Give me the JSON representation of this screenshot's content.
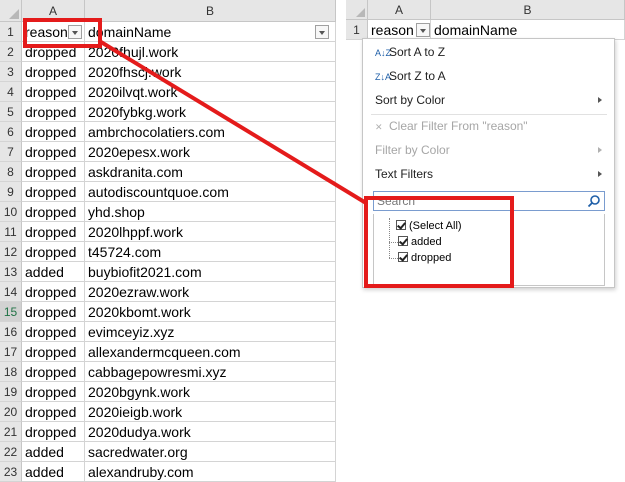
{
  "left_sheet": {
    "col_a": "A",
    "col_b": "B",
    "active_row": 15,
    "rows": [
      {
        "num": "1",
        "a": "reason",
        "b": "domainName"
      },
      {
        "num": "2",
        "a": "dropped",
        "b": "2020fhujl.work"
      },
      {
        "num": "3",
        "a": "dropped",
        "b": "2020fhscj.work"
      },
      {
        "num": "4",
        "a": "dropped",
        "b": "2020ilvqt.work"
      },
      {
        "num": "5",
        "a": "dropped",
        "b": "2020fybkg.work"
      },
      {
        "num": "6",
        "a": "dropped",
        "b": "ambrchocolatiers.com"
      },
      {
        "num": "7",
        "a": "dropped",
        "b": "2020epesx.work"
      },
      {
        "num": "8",
        "a": "dropped",
        "b": "askdranita.com"
      },
      {
        "num": "9",
        "a": "dropped",
        "b": "autodiscountquoe.com"
      },
      {
        "num": "10",
        "a": "dropped",
        "b": "yhd.shop"
      },
      {
        "num": "11",
        "a": "dropped",
        "b": "2020lhppf.work"
      },
      {
        "num": "12",
        "a": "dropped",
        "b": "t45724.com"
      },
      {
        "num": "13",
        "a": "added",
        "b": "buybiofit2021.com"
      },
      {
        "num": "14",
        "a": "dropped",
        "b": "2020ezraw.work"
      },
      {
        "num": "15",
        "a": "dropped",
        "b": "2020kbomt.work"
      },
      {
        "num": "16",
        "a": "dropped",
        "b": "evimceyiz.xyz"
      },
      {
        "num": "17",
        "a": "dropped",
        "b": "allexandermcqueen.com"
      },
      {
        "num": "18",
        "a": "dropped",
        "b": "cabbagepowresmi.xyz"
      },
      {
        "num": "19",
        "a": "dropped",
        "b": "2020bgynk.work"
      },
      {
        "num": "20",
        "a": "dropped",
        "b": "2020ieigb.work"
      },
      {
        "num": "21",
        "a": "dropped",
        "b": "2020dudya.work"
      },
      {
        "num": "22",
        "a": "added",
        "b": "sacredwater.org"
      },
      {
        "num": "23",
        "a": "added",
        "b": "alexandruby.com"
      }
    ]
  },
  "right_sheet": {
    "col_a": "A",
    "col_b": "B",
    "row1_num": "1",
    "row1_a": "reason",
    "row1_b": "domainName"
  },
  "filter_menu": {
    "sort_az": "Sort A to Z",
    "sort_za": "Sort Z to A",
    "sort_by_color": "Sort by Color",
    "clear_filter": "Clear Filter From \"reason\"",
    "filter_by_color": "Filter by Color",
    "text_filters": "Text Filters",
    "search_placeholder": "Search",
    "checklist": [
      {
        "label": "(Select All)",
        "checked": true
      },
      {
        "label": "added",
        "checked": true
      },
      {
        "label": "dropped",
        "checked": true
      }
    ]
  },
  "colors": {
    "annotation_red": "#e41b1b",
    "header_gray": "#e6e6e6",
    "excel_green": "#217346"
  }
}
